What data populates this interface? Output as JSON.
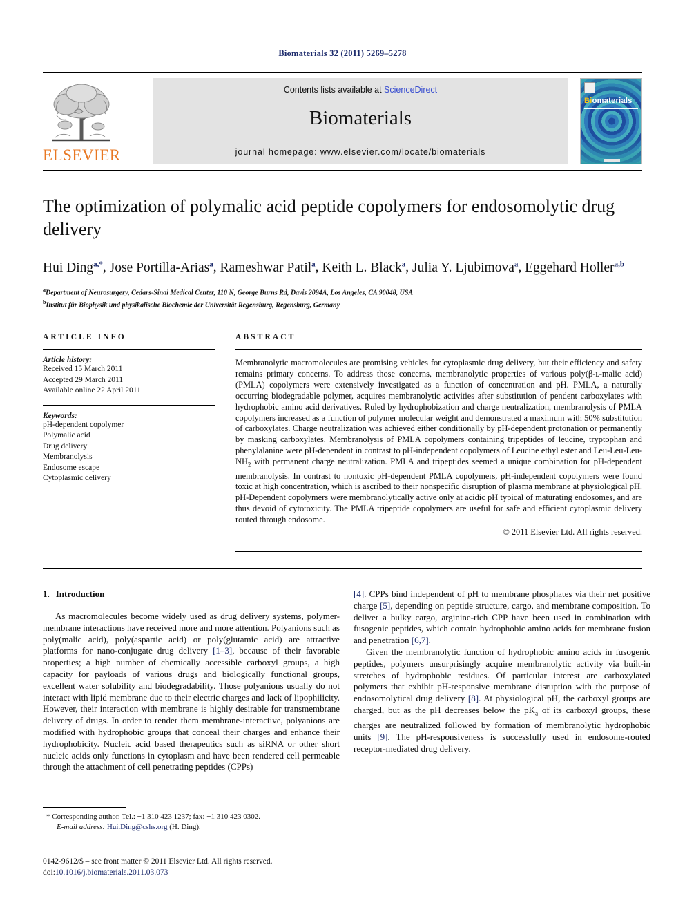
{
  "running_head": "Biomaterials 32 (2011) 5269–5278",
  "masthead": {
    "publisher_name": "ELSEVIER",
    "contents_prefix": "Contents lists available at ",
    "contents_link": "ScienceDirect",
    "journal_name": "Biomaterials",
    "homepage": "journal homepage: www.elsevier.com/locate/biomaterials",
    "cover": {
      "title_first": "Bi",
      "title_rest": "omaterials"
    }
  },
  "title": "The optimization of polymalic acid peptide copolymers for endosomolytic drug delivery",
  "authors": [
    {
      "name": "Hui Ding",
      "marks": "a,*"
    },
    {
      "name": "Jose Portilla-Arias",
      "marks": "a"
    },
    {
      "name": "Rameshwar Patil",
      "marks": "a"
    },
    {
      "name": "Keith L. Black",
      "marks": "a"
    },
    {
      "name": "Julia Y. Ljubimova",
      "marks": "a"
    },
    {
      "name": "Eggehard Holler",
      "marks": "a,b"
    }
  ],
  "affiliations": [
    {
      "mark": "a",
      "text": "Department of Neurosurgery, Cedars-Sinai Medical Center, 110 N, George Burns Rd, Davis 2094A, Los Angeles, CA 90048, USA"
    },
    {
      "mark": "b",
      "text": "Institut für Biophysik und physikalische Biochemie der Universität Regensburg, Regensburg, Germany"
    }
  ],
  "article_info": {
    "heading": "ARTICLE INFO",
    "history_label": "Article history:",
    "history": [
      "Received 15 March 2011",
      "Accepted 29 March 2011",
      "Available online 22 April 2011"
    ],
    "keywords_label": "Keywords:",
    "keywords": [
      "pH-dependent copolymer",
      "Polymalic acid",
      "Drug delivery",
      "Membranolysis",
      "Endosome escape",
      "Cytoplasmic delivery"
    ]
  },
  "abstract": {
    "heading": "ABSTRACT",
    "text_part1": "Membranolytic macromolecules are promising vehicles for cytoplasmic drug delivery, but their efficiency and safety remains primary concerns. To address those concerns, membranolytic properties of various poly(β-ʟ-malic acid) (PMLA) copolymers were extensively investigated as a function of concentration and pH. PMLA, a naturally occurring biodegradable polymer, acquires membranolytic activities after substitution of pendent carboxylates with hydrophobic amino acid derivatives. Ruled by hydrophobization and charge neutralization, membranolysis of PMLA copolymers increased as a function of polymer molecular weight and demonstrated a maximum with 50% substitution of carboxylates. Charge neutralization was achieved either conditionally by pH-dependent protonation or permanently by masking carboxylates. Membranolysis of PMLA copolymers containing tripeptides of leucine, tryptophan and phenylalanine were pH-dependent in contrast to pH-independent copolymers of Leucine ethyl ester and Leu-Leu-Leu-NH",
    "text_sub": "2",
    "text_part2": " with permanent charge neutralization. PMLA and tripeptides seemed a unique combination for pH-dependent membranolysis. In contrast to nontoxic pH-dependent PMLA copolymers, pH-independent copolymers were found toxic at high concentration, which is ascribed to their nonspecific disruption of plasma membrane at physiological pH. pH-Dependent copolymers were membranolytically active only at acidic pH typical of maturating endosomes, and are thus devoid of cytotoxicity. The PMLA tripeptide copolymers are useful for safe and efficient cytoplasmic delivery routed through endosome.",
    "copyright": "© 2011 Elsevier Ltd. All rights reserved."
  },
  "introduction": {
    "number": "1.",
    "title": "Introduction",
    "p1_a": "As macromolecules become widely used as drug delivery systems, polymer-membrane interactions have received more and more attention. Polyanions such as poly(malic acid), poly(aspartic acid) or poly(glutamic acid) are attractive platforms for nano-conjugate drug delivery ",
    "p1_ref": "[1–3]",
    "p1_b": ", because of their favorable properties; a high number of chemically accessible carboxyl groups, a high capacity for payloads of various drugs and biologically functional groups, excellent water solubility and biodegradability. Those polyanions usually do not interact with lipid membrane due to their electric charges and lack of lipophilicity. However, their interaction with membrane is highly desirable for transmembrane delivery of drugs. In order to render them membrane-interactive, polyanions are modified with hydrophobic groups that conceal their charges and enhance their hydrophobicity. Nucleic acid based therapeutics such as siRNA or other short nucleic acids only functions in cytoplasm and have been rendered cell permeable through the attachment of cell penetrating peptides (CPPs) ",
    "p1_ref2": "[4]",
    "p1_c": ". CPPs bind independent of pH to membrane phosphates via their net positive charge ",
    "p1_ref3": "[5]",
    "p1_d": ", depending on peptide structure, cargo, and membrane composition. To deliver a bulky cargo, arginine-rich CPP have been used in combination with fusogenic peptides, which contain hydrophobic amino acids for membrane fusion and penetration ",
    "p1_ref4": "[6,7]",
    "p1_e": ".",
    "p2_a": "Given the membranolytic function of hydrophobic amino acids in fusogenic peptides, polymers unsurprisingly acquire membranolytic activity via built-in stretches of hydrophobic residues. Of particular interest are carboxylated polymers that exhibit pH-responsive membrane disruption with the purpose of endosomolytical drug delivery ",
    "p2_ref": "[8]",
    "p2_b": ". At physiological pH, the carboxyl groups are charged, but as the pH decreases below the pK",
    "p2_sub": "a",
    "p2_c": " of its carboxyl groups, these charges are neutralized followed by formation of membranolytic hydrophobic units ",
    "p2_ref2": "[9]",
    "p2_d": ". The pH-responsiveness is successfully used in endosome-routed receptor-mediated drug delivery."
  },
  "footnote": {
    "corresponding": "* Corresponding author. Tel.: +1 310 423 1237; fax: +1 310 423 0302.",
    "email_label": "E-mail address:",
    "email": "Hui.Ding@cshs.org",
    "email_suffix": "(H. Ding)."
  },
  "footer": {
    "front_matter": "0142-9612/$ – see front matter © 2011 Elsevier Ltd. All rights reserved.",
    "doi_label": "doi:",
    "doi": "10.1016/j.biomaterials.2011.03.073"
  }
}
